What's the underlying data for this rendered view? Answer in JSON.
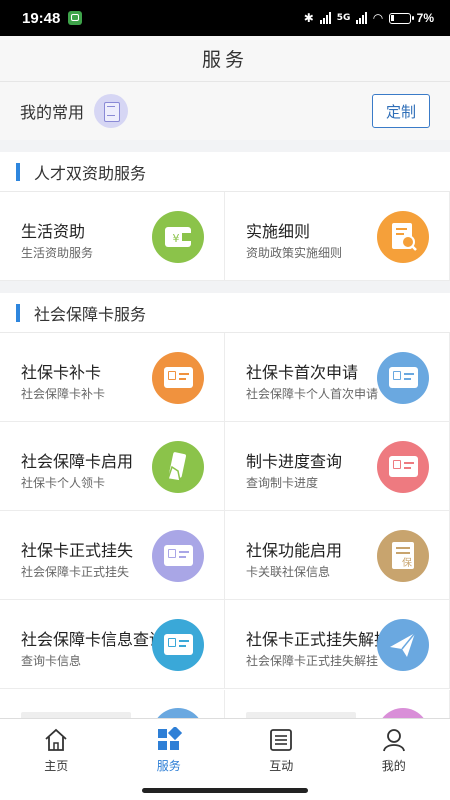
{
  "status_bar": {
    "time": "19:48",
    "network": "5G",
    "battery_text": "7%"
  },
  "header": {
    "title": "服务"
  },
  "favorites": {
    "label": "我的常用",
    "icon": "document-list-icon",
    "customize_label": "定制"
  },
  "sections": [
    {
      "title": "人才双资助服务",
      "items": [
        {
          "title": "生活资助",
          "subtitle": "生活资助服务",
          "icon": "wallet-yen-icon",
          "color": "#8bc34a"
        },
        {
          "title": "实施细则",
          "subtitle": "资助政策实施细则",
          "icon": "document-search-icon",
          "color": "#f5a03a"
        }
      ]
    },
    {
      "title": "社会保障卡服务",
      "items": [
        {
          "title": "社保卡补卡",
          "subtitle": "社会保障卡补卡",
          "icon": "id-card-icon",
          "color": "#f0923e"
        },
        {
          "title": "社保卡首次申请",
          "subtitle": "社会保障卡个人首次申请",
          "icon": "card-pen-icon",
          "color": "#6aa8e0"
        },
        {
          "title": "社会保障卡启用",
          "subtitle": "社保卡个人领卡",
          "icon": "card-hand-icon",
          "color": "#8bc34a"
        },
        {
          "title": "制卡进度查询",
          "subtitle": "查询制卡进度",
          "icon": "card-progress-icon",
          "color": "#ee7a80"
        },
        {
          "title": "社保卡正式挂失",
          "subtitle": "社会保障卡正式挂失",
          "icon": "card-phone-icon",
          "color": "#a9a6e6"
        },
        {
          "title": "社保功能启用",
          "subtitle": "卡关联社保信息",
          "icon": "insurance-doc-icon",
          "color": "#c8a46e"
        },
        {
          "title": "社会保障卡信息查询",
          "subtitle": "查询卡信息",
          "icon": "card-lock-icon",
          "color": "#3aa8d8"
        },
        {
          "title": "社保卡正式挂失解挂",
          "subtitle": "社会保障卡正式挂失解挂",
          "icon": "paper-plane-icon",
          "color": "#6aa8e0"
        }
      ]
    }
  ],
  "bottom_nav": [
    {
      "label": "主页",
      "icon": "home-icon",
      "active": false
    },
    {
      "label": "服务",
      "icon": "grid-icon",
      "active": true
    },
    {
      "label": "互动",
      "icon": "list-icon",
      "active": false
    },
    {
      "label": "我的",
      "icon": "user-icon",
      "active": false
    }
  ],
  "colors": {
    "accent": "#2e7fd6",
    "section_bar": "#2e86de"
  }
}
